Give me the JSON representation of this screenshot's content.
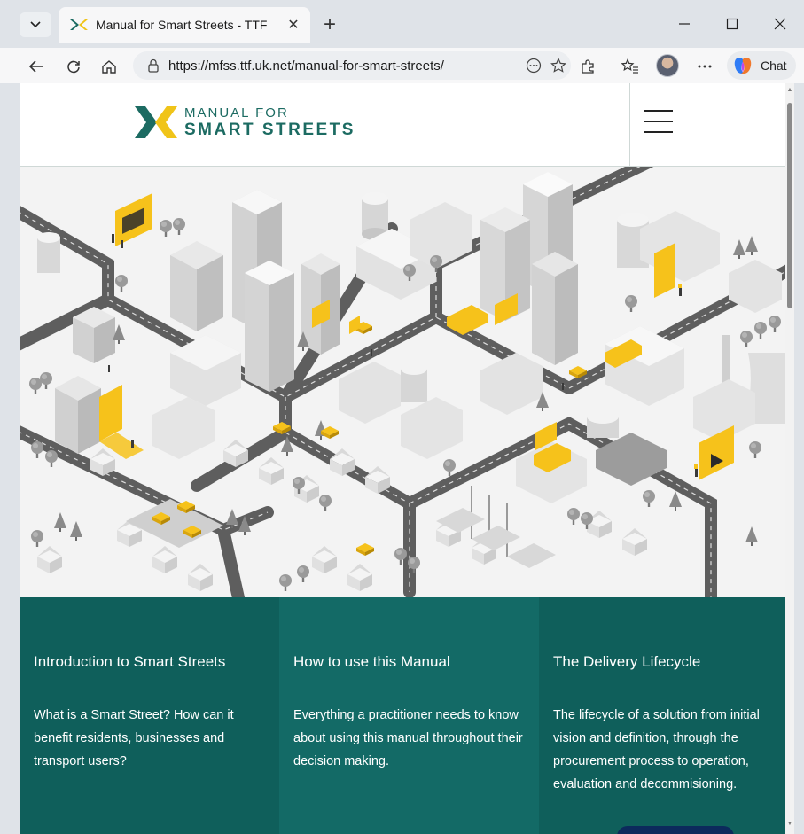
{
  "browser": {
    "tab_title": "Manual for Smart Streets - TTF",
    "url": "https://mfss.ttf.uk.net/manual-for-smart-streets/",
    "chat_label": "Chat",
    "accent": "#0f5f5b"
  },
  "site": {
    "logo_line1": "MANUAL FOR",
    "logo_line2": "SMART STREETS"
  },
  "cards": [
    {
      "title": "Introduction to Smart Streets",
      "description": "What is a Smart Street? How can it benefit residents, businesses and transport users?"
    },
    {
      "title": "How to use this Manual",
      "description": "Everything a practitioner needs to know about using this manual throughout their decision making."
    },
    {
      "title": "The Delivery Lifecycle",
      "description": "The lifecycle of a solution from initial vision and definition, through the procurement process to operation, evaluation and decommisioning."
    }
  ]
}
